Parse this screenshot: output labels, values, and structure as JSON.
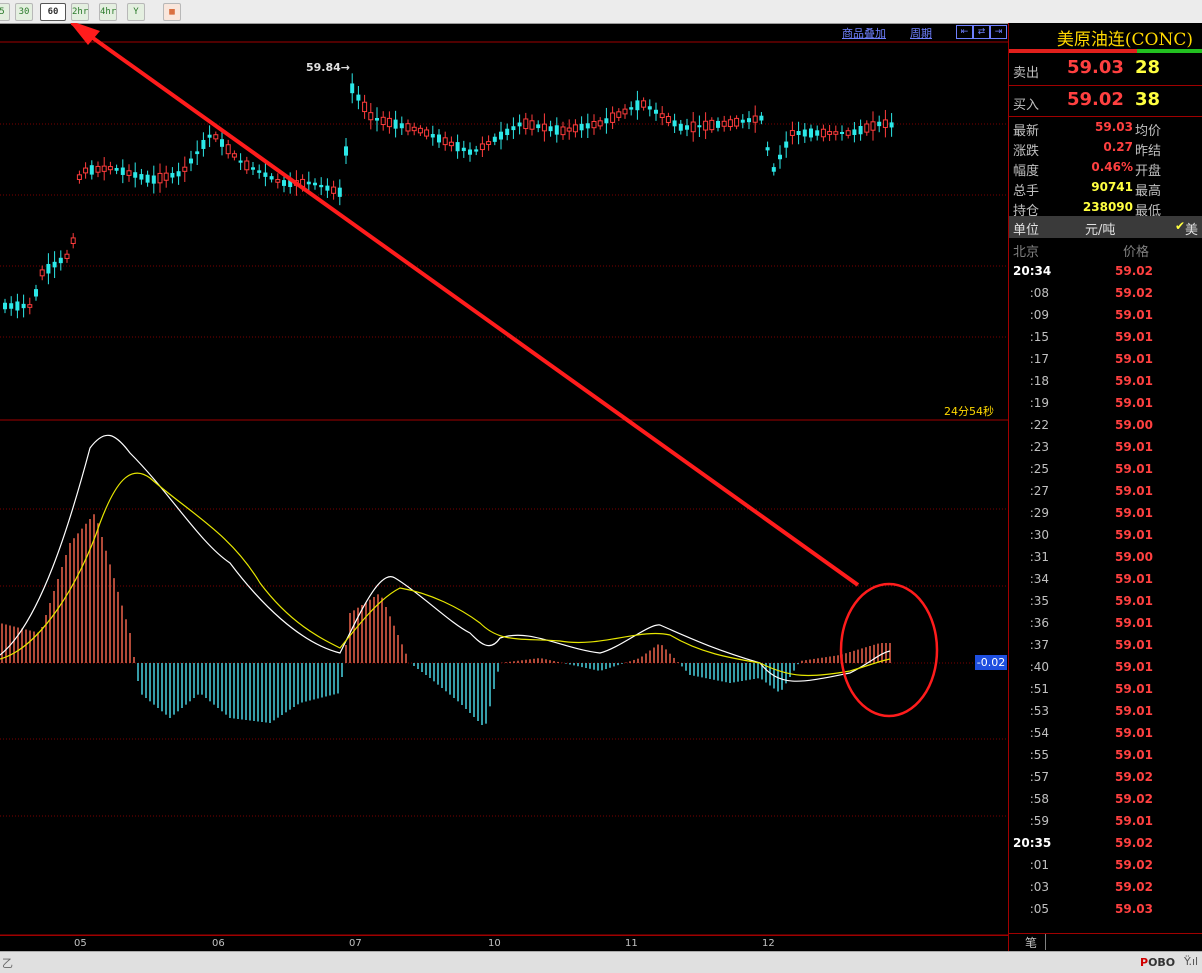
{
  "toolbar": {
    "buttons": [
      {
        "label": "5",
        "state": "normal"
      },
      {
        "label": "30",
        "state": "normal"
      },
      {
        "label": "60",
        "state": "active"
      },
      {
        "label": "2hr",
        "state": "normal"
      },
      {
        "label": "4hr",
        "state": "normal"
      },
      {
        "label": "Y",
        "state": "normal"
      },
      {
        "label": "▦",
        "state": "orange"
      }
    ]
  },
  "chart_header": {
    "overlay_label": "商品叠加",
    "period_label": "周期",
    "window_controls": [
      "⇤",
      "⇄",
      "⇥"
    ]
  },
  "price_chart": {
    "high_marker": "59.84→",
    "countdown": "24分54秒"
  },
  "macd": {
    "current_value": "-0.02"
  },
  "x_axis": {
    "labels": [
      "05",
      "06",
      "07",
      "10",
      "11",
      "12"
    ]
  },
  "annotation": {
    "arrow_color": "#ff1c1c",
    "circle_color": "#ff1c1c"
  },
  "panel": {
    "title": "美原油连(CONC)",
    "sell": {
      "label": "卖出",
      "price": "59.03",
      "volume": "28"
    },
    "buy": {
      "label": "买入",
      "price": "59.02",
      "volume": "38"
    },
    "stats": [
      {
        "key": "最新",
        "value": "59.03",
        "color": "#ff4040",
        "key2": "均价"
      },
      {
        "key": "涨跌",
        "value": "0.27",
        "color": "#ff4040",
        "key2": "昨结"
      },
      {
        "key": "幅度",
        "value": "0.46%",
        "color": "#ff4040",
        "key2": "开盘"
      },
      {
        "key": "总手",
        "value": "90741",
        "color": "#ffff40",
        "key2": "最高"
      },
      {
        "key": "持仓",
        "value": "238090",
        "color": "#ffff40",
        "key2": "最低"
      }
    ],
    "unit_label": "单位",
    "unit_value": "元/吨",
    "unit_extra": "美",
    "tick_header": {
      "time": "北京",
      "price": "价格"
    },
    "ticks": [
      {
        "time": "20:34",
        "price": "59.02",
        "full": true
      },
      {
        "time": ":08",
        "price": "59.02"
      },
      {
        "time": ":09",
        "price": "59.01"
      },
      {
        "time": ":15",
        "price": "59.01"
      },
      {
        "time": ":17",
        "price": "59.01"
      },
      {
        "time": ":18",
        "price": "59.01"
      },
      {
        "time": ":19",
        "price": "59.01"
      },
      {
        "time": ":22",
        "price": "59.00"
      },
      {
        "time": ":23",
        "price": "59.01"
      },
      {
        "time": ":25",
        "price": "59.01"
      },
      {
        "time": ":27",
        "price": "59.01"
      },
      {
        "time": ":29",
        "price": "59.01"
      },
      {
        "time": ":30",
        "price": "59.01"
      },
      {
        "time": ":31",
        "price": "59.00"
      },
      {
        "time": ":34",
        "price": "59.01"
      },
      {
        "time": ":35",
        "price": "59.01"
      },
      {
        "time": ":36",
        "price": "59.01"
      },
      {
        "time": ":37",
        "price": "59.01"
      },
      {
        "time": ":40",
        "price": "59.01"
      },
      {
        "time": ":51",
        "price": "59.01"
      },
      {
        "time": ":53",
        "price": "59.01"
      },
      {
        "time": ":54",
        "price": "59.01"
      },
      {
        "time": ":55",
        "price": "59.01"
      },
      {
        "time": ":57",
        "price": "59.02"
      },
      {
        "time": ":58",
        "price": "59.02"
      },
      {
        "time": ":59",
        "price": "59.01"
      },
      {
        "time": "20:35",
        "price": "59.02",
        "full": true
      },
      {
        "time": ":01",
        "price": "59.02"
      },
      {
        "time": ":03",
        "price": "59.02"
      },
      {
        "time": ":05",
        "price": "59.03"
      }
    ],
    "tab_label": "笔"
  },
  "status_bar": {
    "left_text": "乙",
    "brand_p": "P",
    "brand_rest": "OBO",
    "icons": "Ÿ.ıl"
  }
}
